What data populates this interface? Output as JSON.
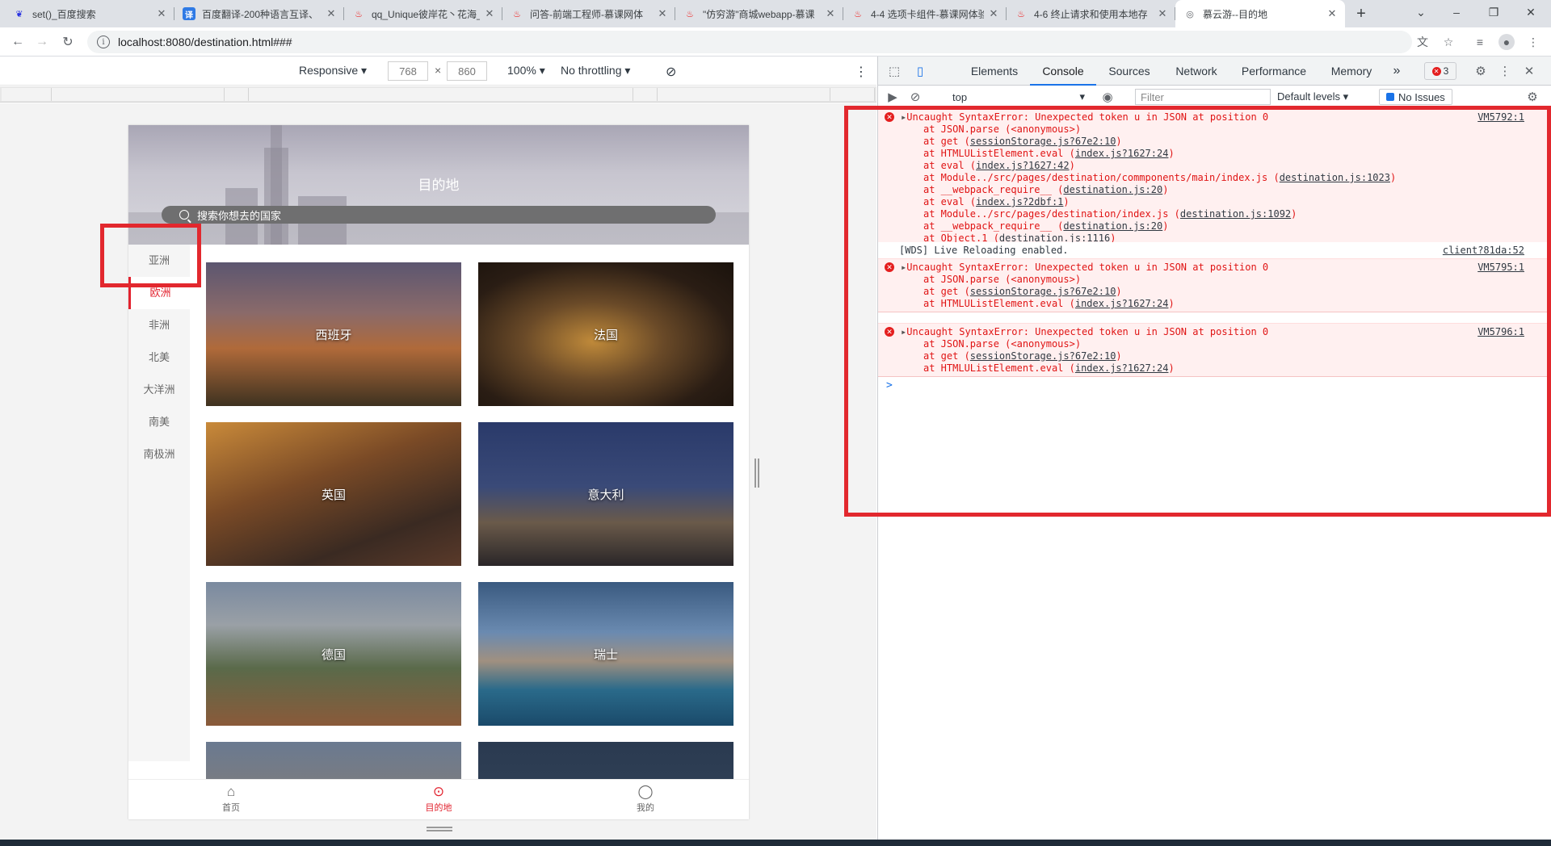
{
  "browser": {
    "tabs": [
      {
        "title": "set()_百度搜索",
        "icon": "baidu-icon",
        "active": false
      },
      {
        "title": "百度翻译-200种语言互译、",
        "icon": "fanyi-icon",
        "active": false
      },
      {
        "title": "qq_Unique彼岸花丶花海_",
        "icon": "fire-icon",
        "active": false
      },
      {
        "title": "问答-前端工程师-慕课网体",
        "icon": "fire-icon",
        "active": false
      },
      {
        "title": "\"仿穷游\"商城webapp-慕课",
        "icon": "fire-icon",
        "active": false
      },
      {
        "title": "4-4 选项卡组件-慕课网体验",
        "icon": "fire-icon",
        "active": false
      },
      {
        "title": "4-6 终止请求和使用本地存",
        "icon": "fire-icon",
        "active": false
      },
      {
        "title": "慕云游--目的地",
        "icon": "globe-icon",
        "active": true
      }
    ],
    "url": "localhost:8080/destination.html###"
  },
  "device_toolbar": {
    "mode": "Responsive",
    "width": "768",
    "height": "860",
    "times": "×",
    "zoom": "100%",
    "throttling": "No throttling"
  },
  "app": {
    "header_title": "目的地",
    "search_placeholder": "搜索你想去的国家",
    "regions": [
      "亚洲",
      "欧洲",
      "非洲",
      "北美",
      "大洋洲",
      "南美",
      "南极洲"
    ],
    "active_region": "欧洲",
    "countries": [
      "西班牙",
      "法国",
      "英国",
      "意大利",
      "德国",
      "瑞士",
      "",
      ""
    ],
    "bottom_nav": [
      {
        "label": "首页",
        "icon": "home-icon"
      },
      {
        "label": "目的地",
        "icon": "location-pin-icon"
      },
      {
        "label": "我的",
        "icon": "user-icon"
      }
    ],
    "active_nav": "目的地"
  },
  "devtools": {
    "tabs": [
      "Elements",
      "Console",
      "Sources",
      "Network",
      "Performance",
      "Memory"
    ],
    "active_tab": "Console",
    "more_tabs": "»",
    "error_count": "3",
    "context": "top",
    "filter_placeholder": "Filter",
    "levels": "Default levels ▾",
    "issues": "No Issues",
    "messages": [
      {
        "type": "error",
        "text": "Uncaught SyntaxError: Unexpected token u in JSON at position 0",
        "source": "VM5792:1",
        "stack": [
          [
            "at JSON.parse (<anonymous>)",
            ""
          ],
          [
            "at get (",
            "sessionStorage.js?67e2:10",
            ")"
          ],
          [
            "at HTMLUListElement.eval (",
            "index.js?1627:24",
            ")"
          ],
          [
            "at eval (",
            "index.js?1627:42",
            ")"
          ],
          [
            "at Module../src/pages/destination/commponents/main/index.js (",
            "destination.js:1023",
            ")"
          ],
          [
            "at __webpack_require__ (",
            "destination.js:20",
            ")"
          ],
          [
            "at eval (",
            "index.js?2dbf:1",
            ")"
          ],
          [
            "at Module../src/pages/destination/index.js (",
            "destination.js:1092",
            ")"
          ],
          [
            "at __webpack_require__ (",
            "destination.js:20",
            ")"
          ],
          [
            "at Object.1 (",
            "destination.js:1116",
            ")"
          ]
        ]
      },
      {
        "type": "log",
        "text": "[WDS] Live Reloading enabled.",
        "source": "client?81da:52",
        "stack": []
      },
      {
        "type": "error",
        "text": "Uncaught SyntaxError: Unexpected token u in JSON at position 0",
        "source": "VM5795:1",
        "stack": [
          [
            "at JSON.parse (<anonymous>)",
            ""
          ],
          [
            "at get (",
            "sessionStorage.js?67e2:10",
            ")"
          ],
          [
            "at HTMLUListElement.eval (",
            "index.js?1627:24",
            ")"
          ]
        ]
      },
      {
        "type": "error",
        "text": "Uncaught SyntaxError: Unexpected token u in JSON at position 0",
        "source": "VM5796:1",
        "stack": [
          [
            "at JSON.parse (<anonymous>)",
            ""
          ],
          [
            "at get (",
            "sessionStorage.js?67e2:10",
            ")"
          ],
          [
            "at HTMLUListElement.eval (",
            "index.js?1627:24",
            ")"
          ]
        ]
      }
    ],
    "prompt": ">"
  },
  "colors": {
    "accent_red": "#e2222e",
    "highlight_box": "#e2282e",
    "devtools_blue": "#1a73e8"
  }
}
